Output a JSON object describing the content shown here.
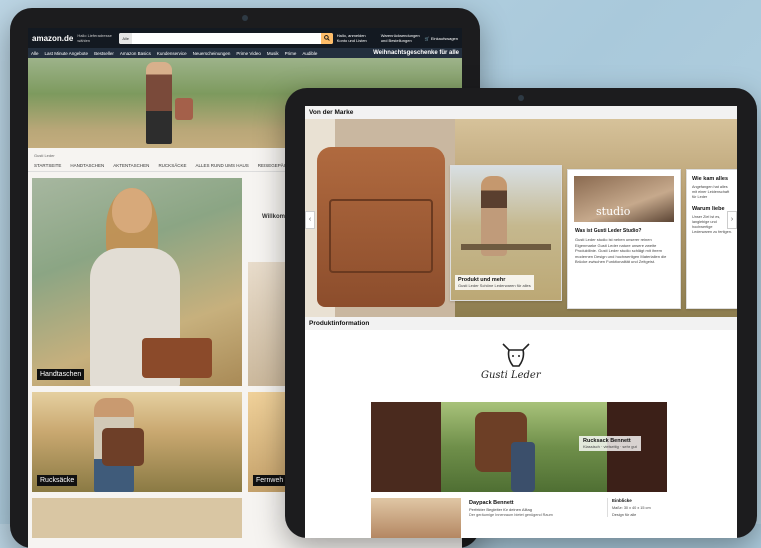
{
  "back_tablet": {
    "header": {
      "logo": "amazon.de",
      "location": "Hallo Lieferadresse wählen",
      "search_category": "Alle",
      "account": "Hallo, anmelden Konto und Listen",
      "orders": "Warenrücksendungen und Bestellungen",
      "cart": "Einkaufswagen"
    },
    "nav": {
      "items": [
        "Alle",
        "Last Minute Angebote",
        "Bestseller",
        "Amazon Basics",
        "Kundenservice",
        "Neuerscheinungen",
        "Prime Video",
        "Musik",
        "Prime",
        "Audible"
      ],
      "promo": "Weihnachtsgeschenke für alle"
    },
    "breadcrumb": "Gusti Leder",
    "store_nav": [
      "STARTSEITE",
      "HANDTASCHEN",
      "AKTENTASCHEN",
      "RUCKSÄCKE",
      "ALLES RUND UMS HAUS",
      "REISEGEPÄCK"
    ],
    "tiles": {
      "hand_label": "Handtaschen",
      "ruck_label": "Rucksäcke",
      "fern_label": "Fernweh",
      "willk": "Willkommen"
    }
  },
  "front_tablet": {
    "brand_title": "Von der Marke",
    "prod_card": {
      "title": "Produkt und mehr",
      "sub": "Gusti Leder Schöne Lederwaren für alles"
    },
    "studio_card": {
      "word": "studio",
      "question": "Was ist Gusti Leder Studio?",
      "text": "Gusti Leder studio ist neben unserer reinen Eigenmarke Gusti Leder nature unsere zweite Produktlinie. Gusti Leder studio schlägt mit ihrem modernen Design und hochwertigen Materialien die Brücke zwischen Funktionalität und Zeitgeist."
    },
    "wie_card": {
      "title": "Wie kam alles",
      "text": "Angefangen hat alles mit einer Leidenschaft für Leder",
      "why": "Warum liebe",
      "why_text": "Unser Ziel ist es, langlebige und hochwertige Lederwaren zu fertigen."
    },
    "product_title": "Produktinformation",
    "logo_word": "Gusti Leder",
    "ruck_banner": {
      "title": "Rucksack Bennett",
      "sub": "Klassisch · vielseitig · sehr gut"
    },
    "daypack": {
      "title": "Daypack Bennett",
      "sub": "Perfekter Begleiter für deinen Alltag",
      "text": "Der geräumige Innenraum bietet genügend Raum",
      "side_title": "Einblicke",
      "side_items": [
        "Maße: 30 x 40 x 15 cm",
        "Design für alle"
      ]
    }
  }
}
